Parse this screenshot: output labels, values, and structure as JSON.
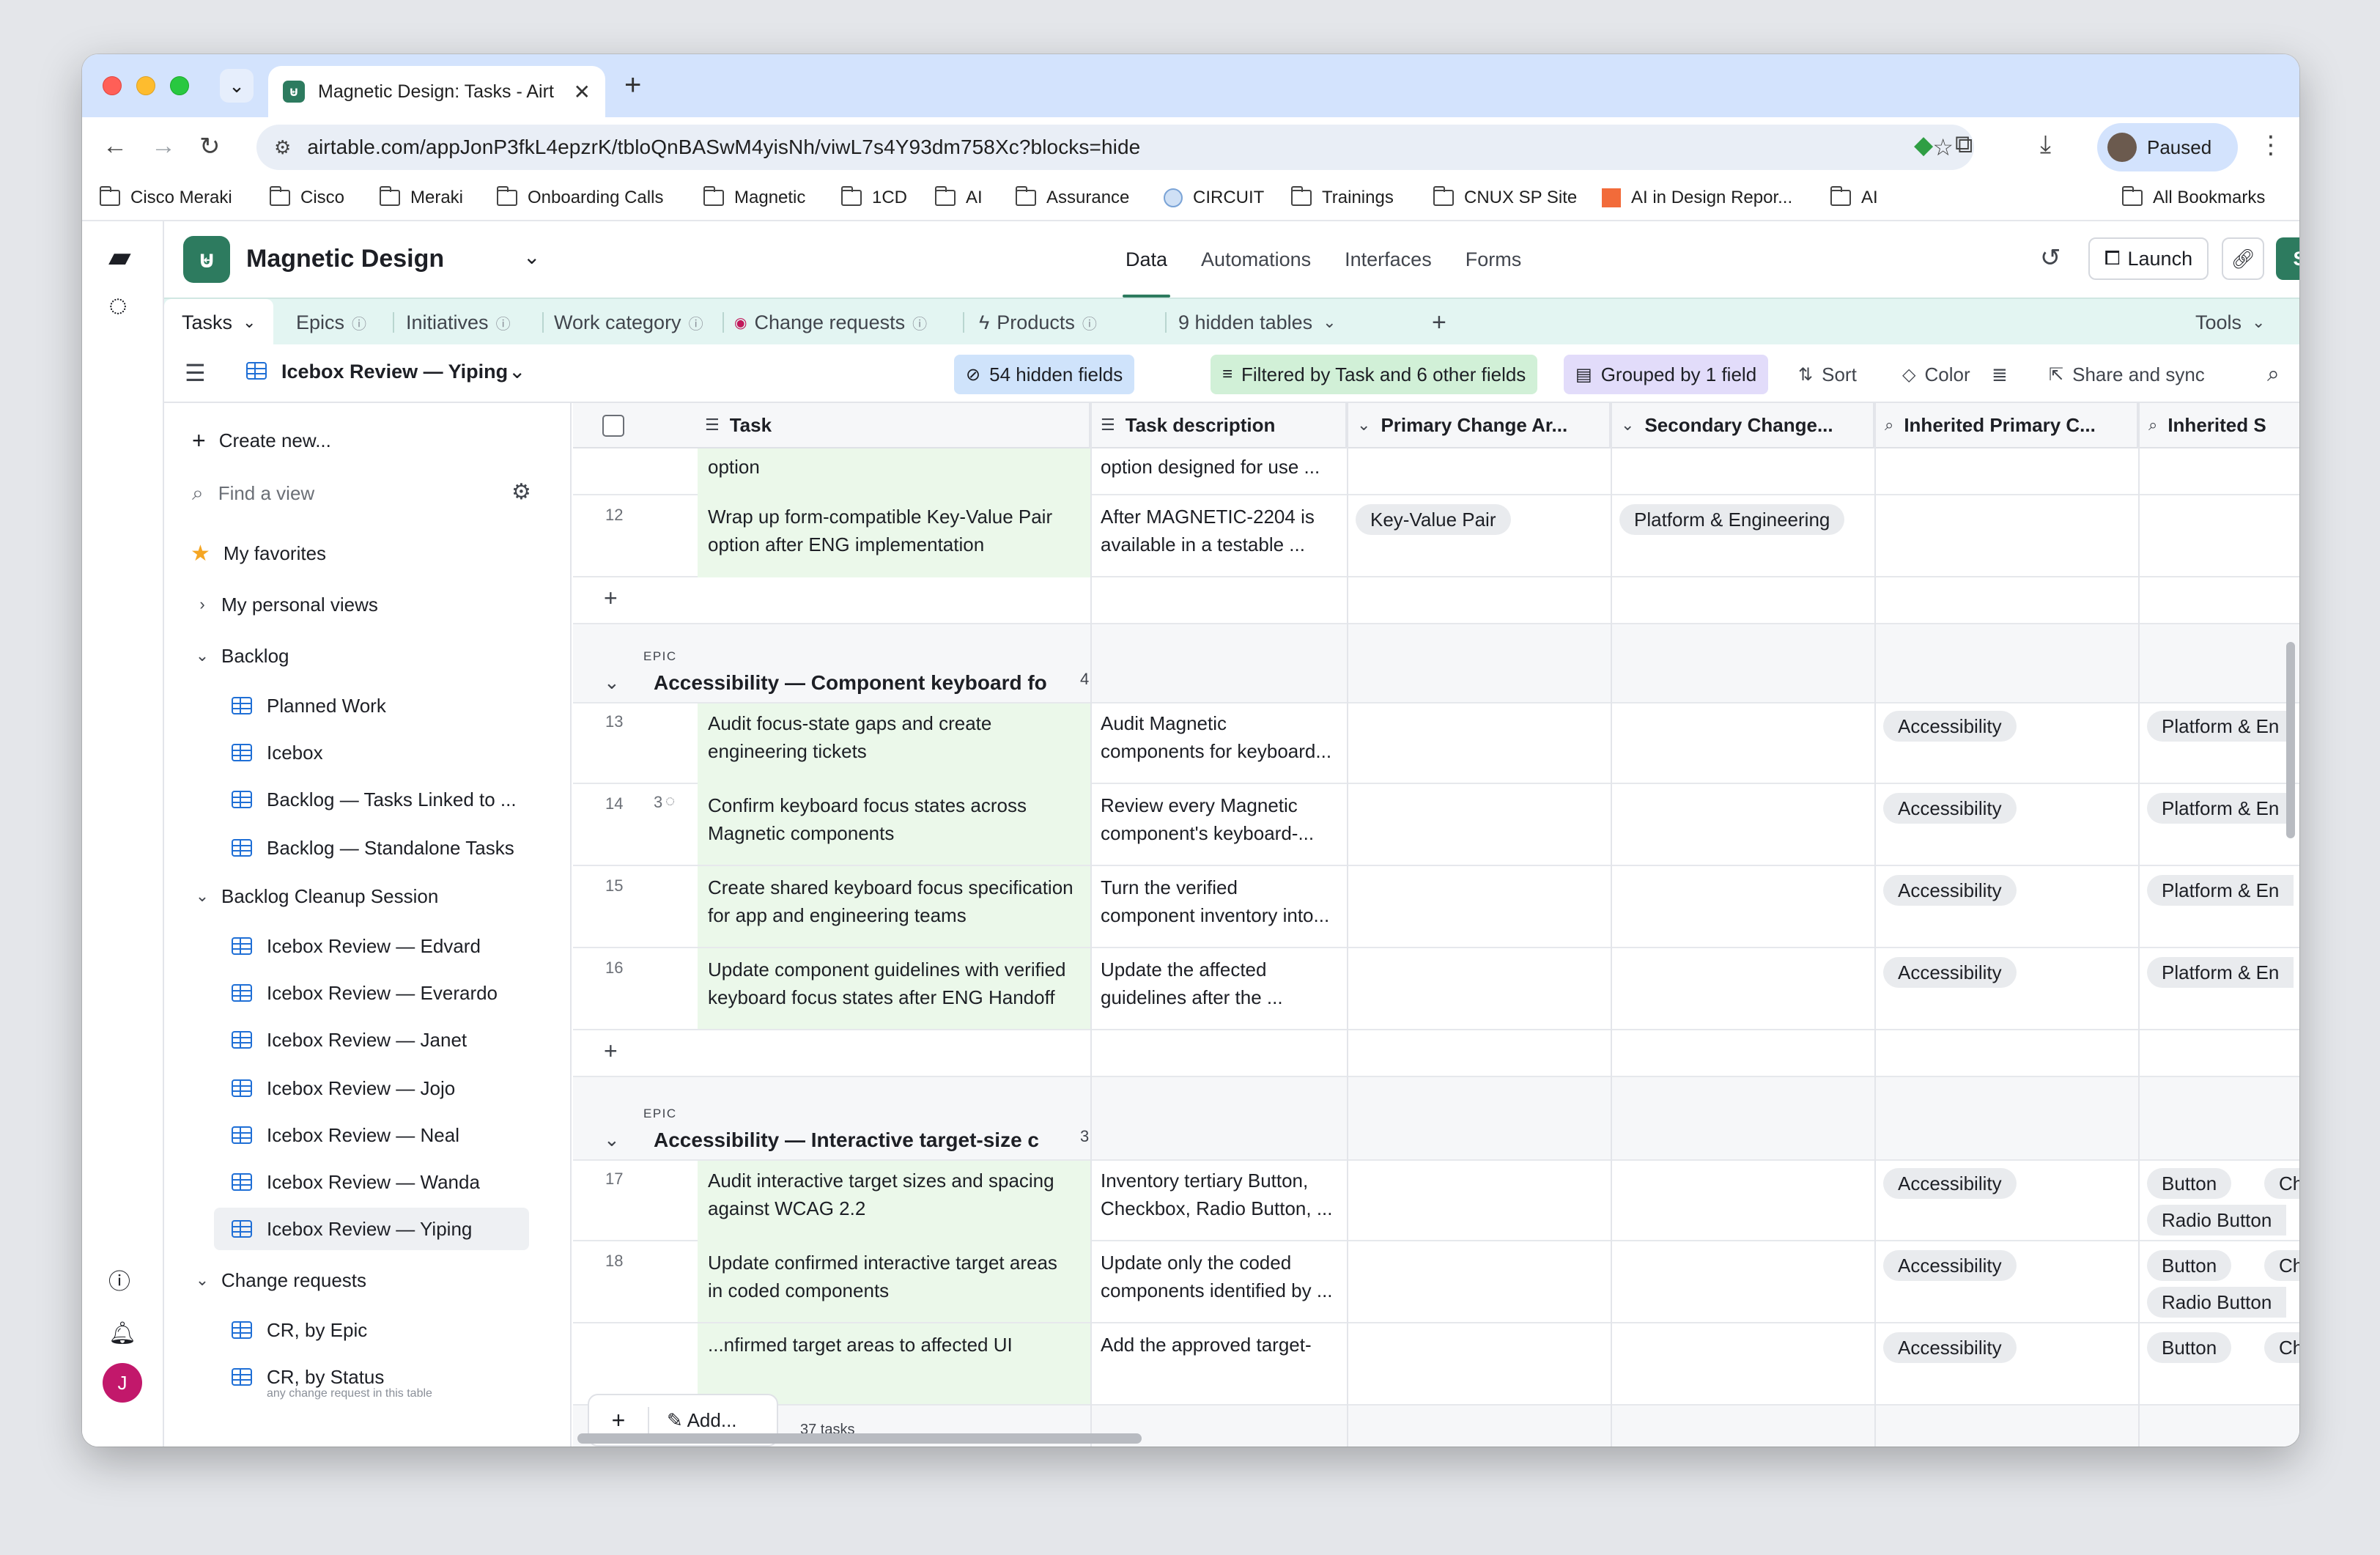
{
  "browser": {
    "tab_title": "Magnetic Design: Tasks - Airt",
    "url": "airtable.com/appJonP3fkL4epzrK/tbloQnBASwM4yisNh/viwL7s4Y93dm758Xc?blocks=hide",
    "profile_label": "Paused",
    "bookmarks": [
      "Cisco Meraki",
      "Cisco",
      "Meraki",
      "Onboarding Calls",
      "Magnetic",
      "1CD",
      "AI",
      "Assurance",
      "CIRCUIT",
      "Trainings",
      "CNUX SP Site",
      "AI in Design Repor...",
      "AI"
    ],
    "all_bookmarks": "All Bookmarks"
  },
  "app": {
    "base_name": "Magnetic Design",
    "nav": [
      "Data",
      "Automations",
      "Interfaces",
      "Forms"
    ],
    "launch_label": "Launch",
    "share_label": "Share",
    "avatar_initial": "J",
    "tables": [
      "Tasks",
      "Epics",
      "Initiatives",
      "Work category",
      "Change requests",
      "Products",
      "9 hidden tables"
    ],
    "tools_label": "Tools"
  },
  "viewbar": {
    "view_name": "Icebox Review — Yiping",
    "hidden_fields": "54 hidden fields",
    "filter": "Filtered by Task and 6 other fields",
    "group": "Grouped by 1 field",
    "sort": "Sort",
    "color": "Color",
    "share_sync": "Share and sync"
  },
  "sidebar": {
    "create_new": "Create new...",
    "find_placeholder": "Find a view",
    "my_favorites": "My favorites",
    "my_personal_views": "My personal views",
    "sections": [
      {
        "title": "Backlog",
        "items": [
          "Planned Work",
          "Icebox",
          "Backlog — Tasks Linked to ...",
          "Backlog — Standalone Tasks"
        ]
      },
      {
        "title": "Backlog Cleanup Session",
        "items": [
          "Icebox Review — Edvard",
          "Icebox Review — Everardo",
          "Icebox Review — Janet",
          "Icebox Review — Jojo",
          "Icebox Review — Neal",
          "Icebox Review — Wanda",
          "Icebox Review — Yiping"
        ]
      },
      {
        "title": "Change requests",
        "items": [
          "CR, by Epic",
          "CR, by Status"
        ]
      }
    ],
    "cut_text": "any change request in this table"
  },
  "grid": {
    "columns": [
      "Task",
      "Task description",
      "Primary Change Ar...",
      "Secondary Change...",
      "Inherited Primary C...",
      "Inherited S"
    ],
    "top_partial": {
      "task": "option",
      "desc": "option designed for use ..."
    },
    "row12": {
      "num": "12",
      "task": [
        "Wrap up form-compatible Key-Value Pair",
        "option after ENG implementation"
      ],
      "desc": [
        "After MAGNETIC-2204 is",
        "available in a testable ..."
      ],
      "primary": "Key-Value Pair",
      "secondary": "Platform & Engineering"
    },
    "groups": [
      {
        "label": "EPIC",
        "title": "Accessibility — Component keyboard fo",
        "count": "4",
        "rows": [
          {
            "num": "13",
            "comments": "",
            "task": [
              "Audit focus-state gaps and create",
              "engineering tickets"
            ],
            "desc": [
              "Audit Magnetic",
              "components for keyboard..."
            ],
            "inh_primary": "Accessibility",
            "inh_second": "Platform & En"
          },
          {
            "num": "14",
            "comments": "3",
            "task": [
              "Confirm keyboard focus states across",
              "Magnetic components"
            ],
            "desc": [
              "Review every Magnetic",
              "component's keyboard-..."
            ],
            "inh_primary": "Accessibility",
            "inh_second": "Platform & En"
          },
          {
            "num": "15",
            "comments": "",
            "task": [
              "Create shared keyboard focus specification",
              "for app and engineering teams"
            ],
            "desc": [
              "Turn the verified",
              "component inventory into..."
            ],
            "inh_primary": "Accessibility",
            "inh_second": "Platform & En"
          },
          {
            "num": "16",
            "comments": "",
            "task": [
              "Update component guidelines with verified",
              "keyboard focus states after ENG Handoff"
            ],
            "desc": [
              "Update the affected",
              "guidelines after the ..."
            ],
            "inh_primary": "Accessibility",
            "inh_second": "Platform & En"
          }
        ]
      },
      {
        "label": "EPIC",
        "title": "Accessibility — Interactive target-size c",
        "count": "3",
        "rows": [
          {
            "num": "17",
            "task": [
              "Audit interactive target sizes and spacing",
              "against WCAG 2.2"
            ],
            "desc": [
              "Inventory tertiary Button,",
              "Checkbox, Radio Button, ..."
            ],
            "inh_primary": "Accessibility",
            "inh_second": [
              "Button",
              "Ch",
              "Radio Button"
            ]
          },
          {
            "num": "18",
            "task": [
              "Update confirmed interactive target areas",
              "in coded components"
            ],
            "desc": [
              "Update only the coded",
              "components identified by ..."
            ],
            "inh_primary": "Accessibility",
            "inh_second": [
              "Button",
              "Ch",
              "Radio Button"
            ]
          },
          {
            "num": "",
            "task": [
              "...nfirmed target areas to affected UI"
            ],
            "desc": [
              "Add the approved target-"
            ],
            "inh_primary": "Accessibility",
            "inh_second": [
              "Button",
              "Ch"
            ]
          }
        ]
      }
    ],
    "add_label": "Add...",
    "record_count": "37 tasks"
  }
}
